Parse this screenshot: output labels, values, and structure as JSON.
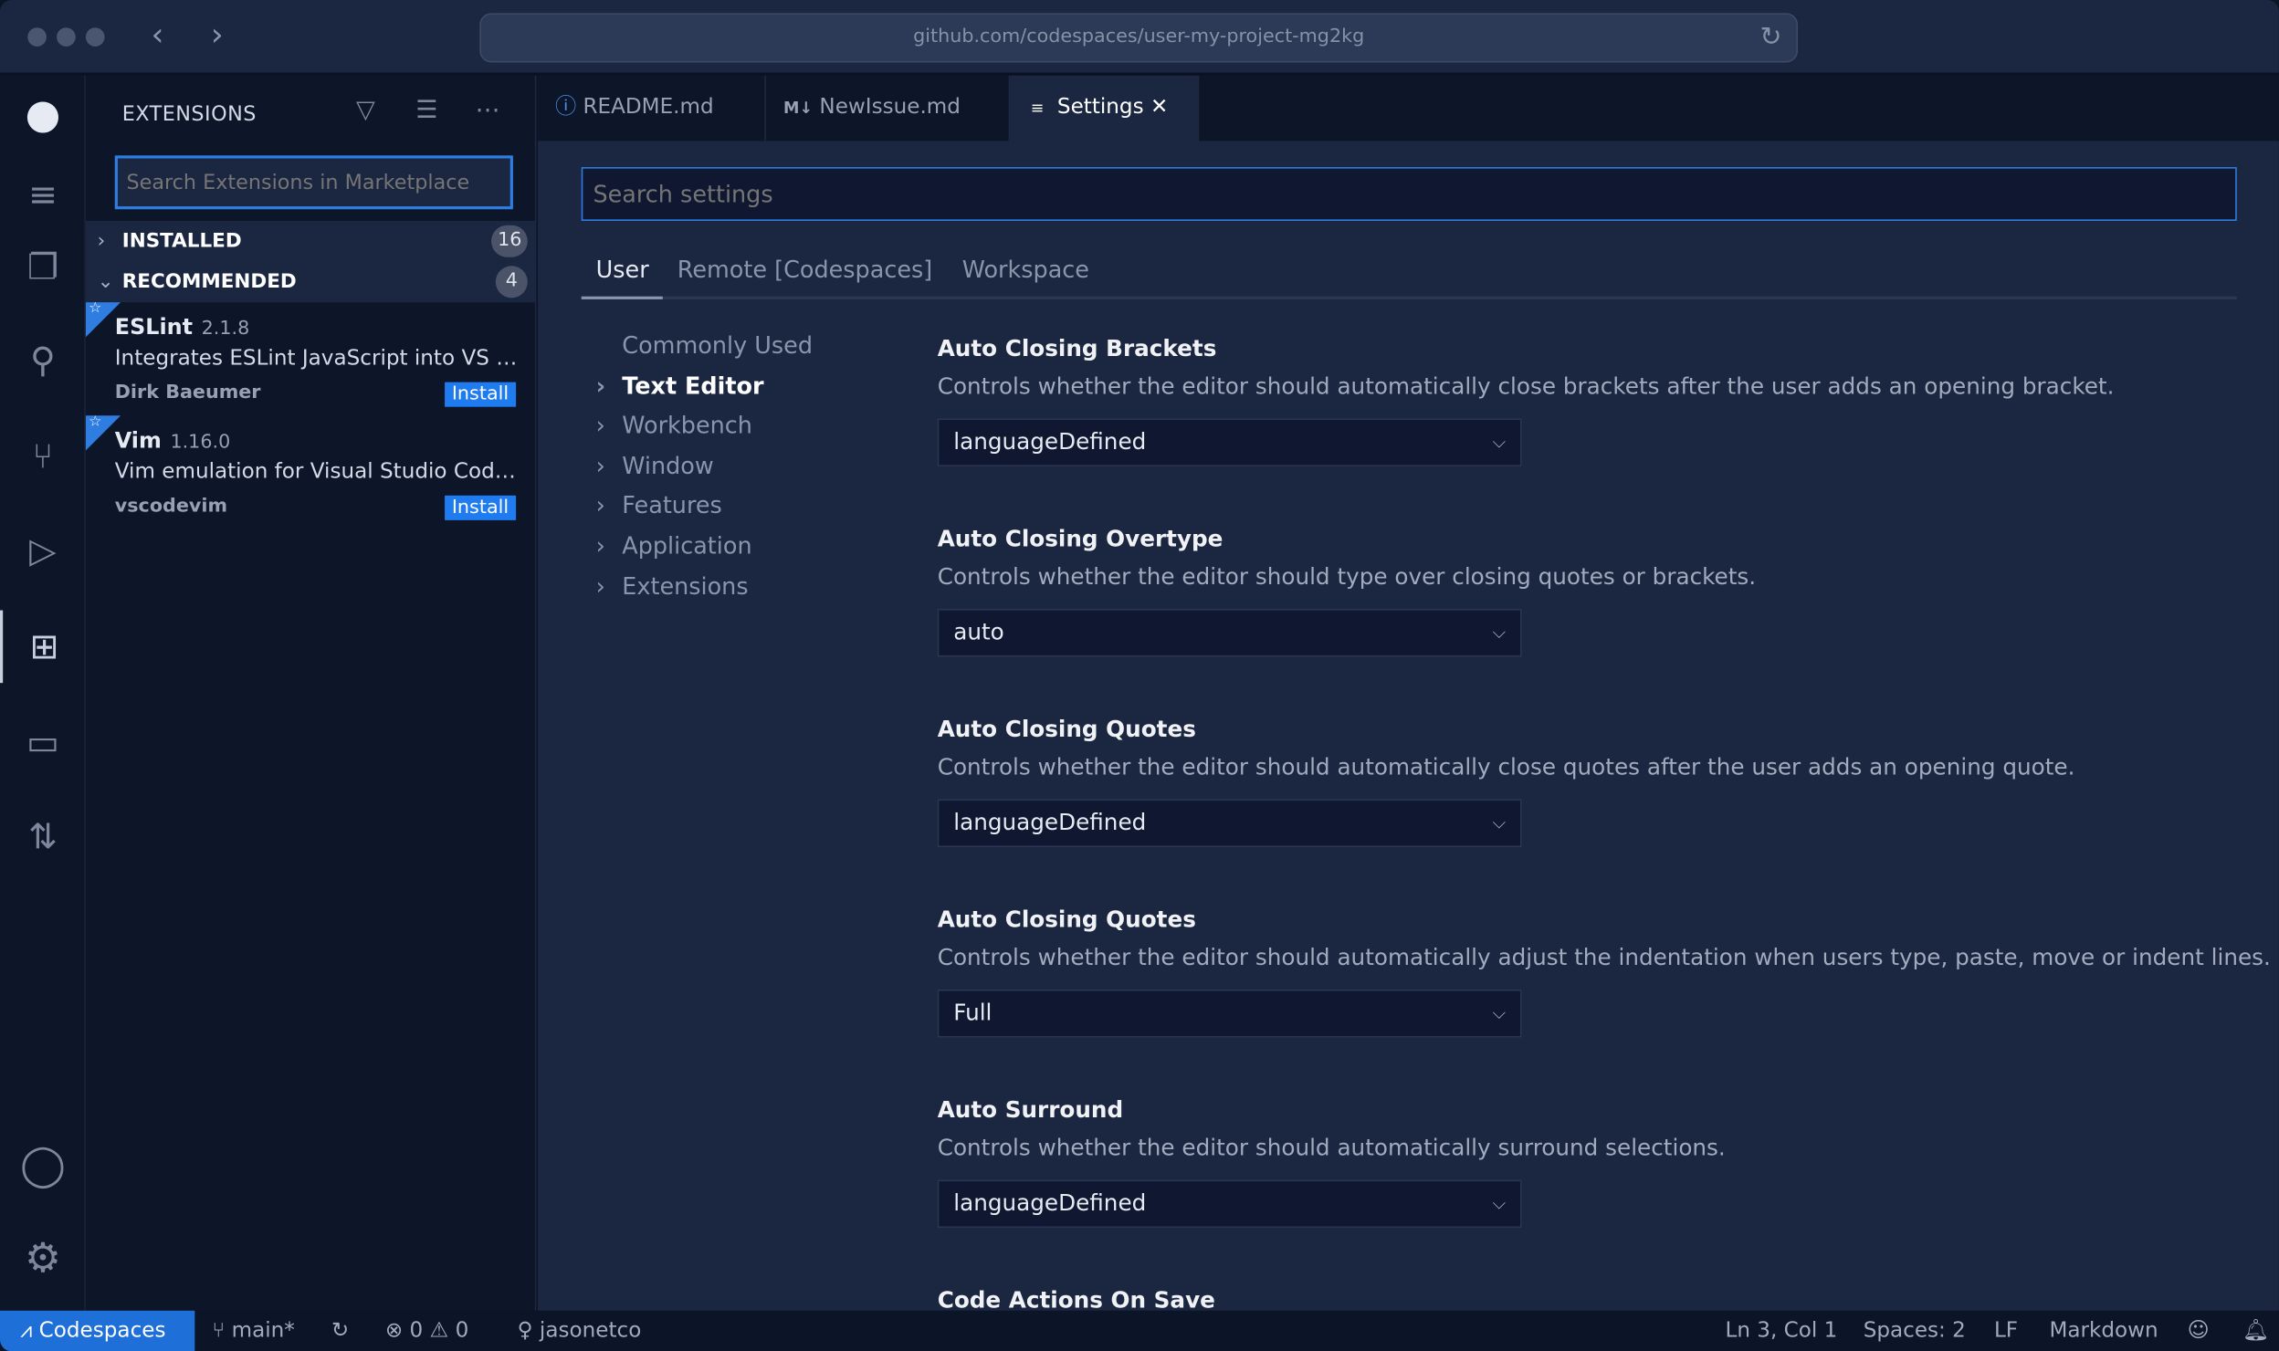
{
  "browser": {
    "url": "github.com/codespaces/user-my-project-mg2kg"
  },
  "sidebar": {
    "title": "EXTENSIONS",
    "search_placeholder": "Search Extensions in Marketplace",
    "sections": [
      {
        "label": "INSTALLED",
        "count": "16",
        "expanded": false
      },
      {
        "label": "RECOMMENDED",
        "count": "4",
        "expanded": true
      }
    ],
    "extensions": [
      {
        "name": "ESLint",
        "version": "2.1.8",
        "description": "Integrates ESLint JavaScript into VS Code.",
        "publisher": "Dirk Baeumer",
        "action": "Install"
      },
      {
        "name": "Vim",
        "version": "1.16.0",
        "description": "Vim emulation for Visual Studio Code...",
        "publisher": "vscodevim",
        "action": "Install"
      }
    ]
  },
  "tabs": [
    {
      "label": "README.md",
      "icon": "info-icon"
    },
    {
      "label": "NewIssue.md",
      "icon": "markdown-icon"
    },
    {
      "label": "Settings",
      "icon": "settings-file-icon",
      "active": true
    }
  ],
  "settings": {
    "search_placeholder": "Search settings",
    "scopes": [
      "User",
      "Remote [Codespaces]",
      "Workspace"
    ],
    "toc": [
      "Commonly Used",
      "Text Editor",
      "Workbench",
      "Window",
      "Features",
      "Application",
      "Extensions"
    ],
    "items": [
      {
        "title": "Auto Closing Brackets",
        "description": "Controls whether the editor should automatically close brackets after the user adds an opening bracket.",
        "value": "languageDefined"
      },
      {
        "title": "Auto Closing Overtype",
        "description": "Controls whether the editor should type over closing quotes or brackets.",
        "value": "auto"
      },
      {
        "title": "Auto Closing Quotes",
        "description": "Controls whether the editor should automatically close quotes after the user adds an opening quote.",
        "value": "languageDefined"
      },
      {
        "title": "Auto Closing Quotes",
        "description": "Controls whether the editor should automatically adjust the indentation when users type, paste, move or indent lines.",
        "value": "Full"
      },
      {
        "title": "Auto Surround",
        "description": "Controls whether the editor should automatically surround selections.",
        "value": "languageDefined"
      },
      {
        "title": "Code Actions On Save"
      }
    ]
  },
  "status": {
    "remote": "Codespaces",
    "branch": "main*",
    "errors": "0",
    "warnings": "0",
    "user": "jasonetco",
    "position": "Ln 3, Col 1",
    "spaces": "Spaces: 2",
    "eol": "LF",
    "language": "Markdown"
  },
  "colors": {
    "accent": "#1f7bf0",
    "background": "#0d1529",
    "editor": "#1b2640"
  }
}
